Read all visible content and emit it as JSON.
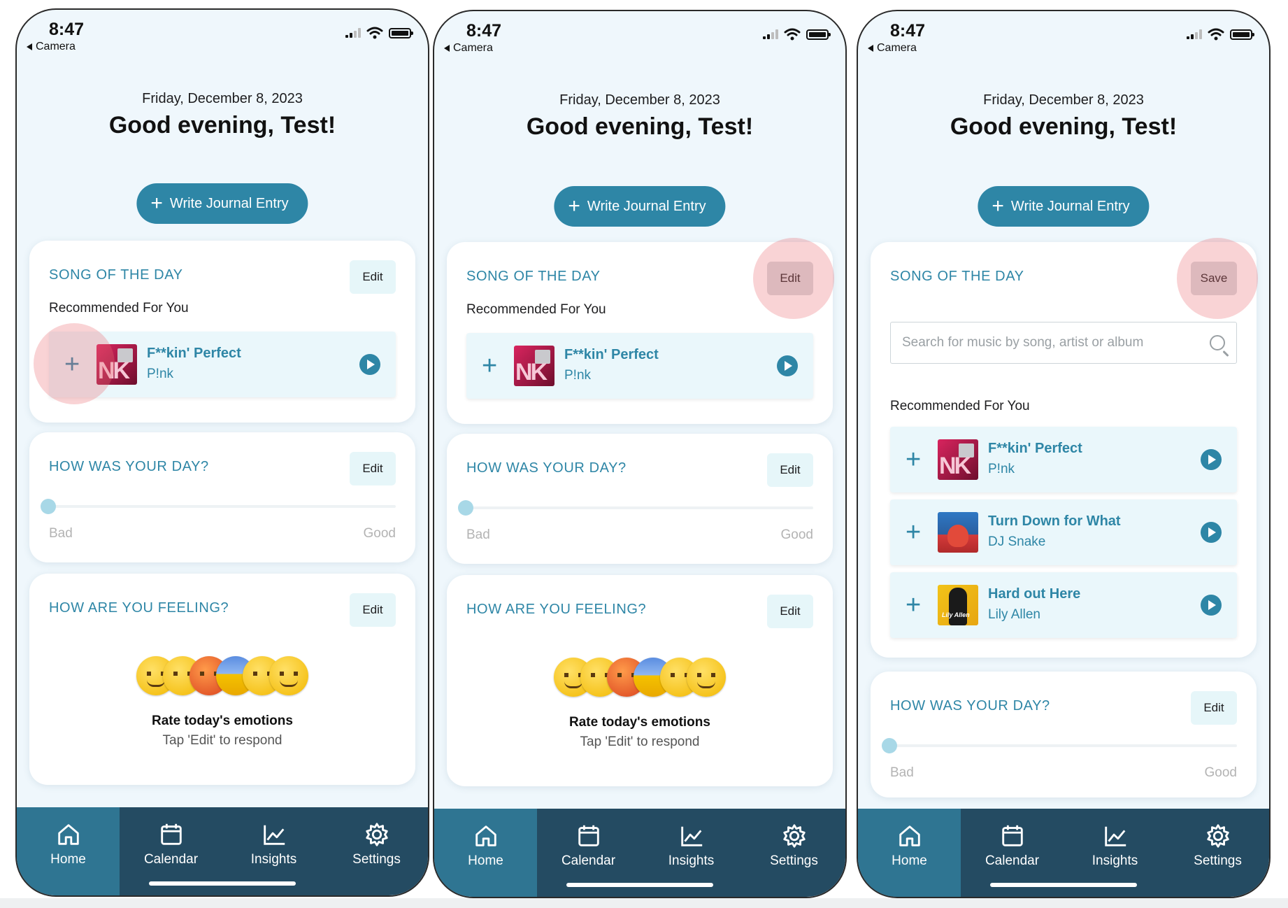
{
  "status": {
    "time": "8:47",
    "back": "Camera"
  },
  "header": {
    "date": "Friday, December 8, 2023",
    "greeting": "Good evening, Test!"
  },
  "write_button": {
    "label": "Write Journal Entry"
  },
  "song_card": {
    "title": "SONG OF THE DAY",
    "edit_label": "Edit",
    "save_label": "Save",
    "recommended_label": "Recommended For You"
  },
  "search": {
    "placeholder": "Search for music by song, artist or album"
  },
  "songs": [
    {
      "title": "F**kin' Perfect",
      "artist": "P!nk"
    },
    {
      "title": "Turn Down for What",
      "artist": "DJ Snake"
    },
    {
      "title": "Hard out Here",
      "artist": "Lily Allen"
    }
  ],
  "day_card": {
    "title": "HOW WAS YOUR DAY?",
    "edit_label": "Edit",
    "bad": "Bad",
    "good": "Good",
    "value": 0
  },
  "feeling_card": {
    "title": "HOW ARE YOU FEELING?",
    "edit_label": "Edit",
    "prompt": "Rate today's emotions",
    "hint": "Tap 'Edit' to respond"
  },
  "album_text": {
    "lily": "Lily Allen"
  },
  "tabs": [
    {
      "label": "Home",
      "icon": "home-icon"
    },
    {
      "label": "Calendar",
      "icon": "calendar-icon"
    },
    {
      "label": "Insights",
      "icon": "chart-icon"
    },
    {
      "label": "Settings",
      "icon": "gear-icon"
    }
  ],
  "colors": {
    "accent": "#2e86a6",
    "tabbar": "#244b62",
    "tab_active": "#2f7592",
    "highlight": "#eb6e73",
    "background": "#eff7fc"
  }
}
